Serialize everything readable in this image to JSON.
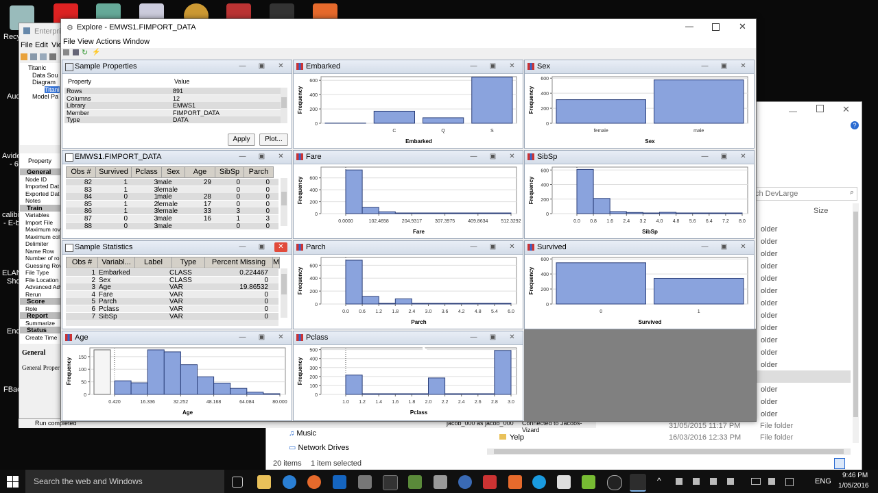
{
  "desktop": {
    "labels": [
      {
        "text": "Recy",
        "x": 5,
        "y": 48
      },
      {
        "text": "Aud",
        "x": 10,
        "y": 135
      },
      {
        "text": "Avide",
        "x": 3,
        "y": 222
      },
      {
        "text": "- 6",
        "x": 14,
        "y": 234
      },
      {
        "text": "calibi",
        "x": 3,
        "y": 308
      },
      {
        "text": "- E-b",
        "x": 5,
        "y": 320
      },
      {
        "text": "ELAN",
        "x": 3,
        "y": 393
      },
      {
        "text": "Sho",
        "x": 10,
        "y": 405
      },
      {
        "text": "Enc",
        "x": 10,
        "y": 478
      },
      {
        "text": "FBac",
        "x": 5,
        "y": 563
      }
    ]
  },
  "enterprise_miner": {
    "title": "Enterpri",
    "menu": [
      "File",
      "Edit",
      "Vie"
    ],
    "tree": [
      "Titanic",
      "Data Sou",
      "Diagram",
      "Titani",
      "Model Pa"
    ],
    "prop_header": "Property",
    "props": [
      {
        "t": "General",
        "sec": true
      },
      {
        "t": "Node ID"
      },
      {
        "t": "Imported Dat"
      },
      {
        "t": "Exported Dat"
      },
      {
        "t": "Notes"
      },
      {
        "t": "Train",
        "sec": true
      },
      {
        "t": "Variables"
      },
      {
        "t": "Import File"
      },
      {
        "t": "Maximum rov"
      },
      {
        "t": "Maximum col"
      },
      {
        "t": "Delimiter"
      },
      {
        "t": "Name Row"
      },
      {
        "t": "Number of ro"
      },
      {
        "t": "Guessing Rov"
      },
      {
        "t": "File Type"
      },
      {
        "t": "File Location"
      },
      {
        "t": "Advanced Adv"
      },
      {
        "t": "Rerun"
      },
      {
        "t": "Score",
        "sec": true
      },
      {
        "t": "Role"
      },
      {
        "t": "Report",
        "sec": true
      },
      {
        "t": "Summarize"
      },
      {
        "t": "Status",
        "sec": true
      },
      {
        "t": "Create Time"
      }
    ],
    "general_label": "General",
    "general_prop": "General Proper",
    "status": "Run completed",
    "status2": "jacob_000 as jacob_000",
    "status3": "Connected to Jacobs-Vizard"
  },
  "explore": {
    "title": "Explore - EMWS1.FIMPORT_DATA",
    "menu": [
      "File",
      "View",
      "Actions",
      "Window"
    ]
  },
  "sample_properties": {
    "title": "Sample Properties",
    "headers": [
      "Property",
      "Value"
    ],
    "rows": [
      [
        "Rows",
        "891"
      ],
      [
        "Columns",
        "12"
      ],
      [
        "Library",
        "EMWS1"
      ],
      [
        "Member",
        "FIMPORT_DATA"
      ],
      [
        "Type",
        "DATA"
      ]
    ],
    "apply": "Apply",
    "plot": "Plot..."
  },
  "data_table": {
    "title": "EMWS1.FIMPORT_DATA",
    "headers": [
      "Obs #",
      "Survived",
      "Pclass",
      "Sex",
      "Age",
      "SibSp",
      "Parch"
    ],
    "rows": [
      [
        "82",
        "1",
        "3",
        "male",
        "29",
        "0",
        "0"
      ],
      [
        "83",
        "1",
        "3",
        "female",
        "",
        "0",
        "0"
      ],
      [
        "84",
        "0",
        "1",
        "male",
        "28",
        "0",
        "0"
      ],
      [
        "85",
        "1",
        "2",
        "female",
        "17",
        "0",
        "0"
      ],
      [
        "86",
        "1",
        "3",
        "female",
        "33",
        "3",
        "0"
      ],
      [
        "87",
        "0",
        "3",
        "male",
        "16",
        "1",
        "3"
      ],
      [
        "88",
        "0",
        "3",
        "male",
        "",
        "0",
        "0"
      ]
    ]
  },
  "sample_stats": {
    "title": "Sample Statistics",
    "headers": [
      "Obs #",
      "Variabl...",
      "Label",
      "Type",
      "Percent Missing",
      "Mi"
    ],
    "rows": [
      [
        "1",
        "Embarked",
        "",
        "CLASS",
        "0.224467"
      ],
      [
        "2",
        "Sex",
        "",
        "CLASS",
        "0"
      ],
      [
        "3",
        "Age",
        "",
        "VAR",
        "19.86532"
      ],
      [
        "4",
        "Fare",
        "",
        "VAR",
        "0"
      ],
      [
        "5",
        "Parch",
        "",
        "VAR",
        "0"
      ],
      [
        "6",
        "Pclass",
        "",
        "VAR",
        "0"
      ],
      [
        "7",
        "SibSp",
        "",
        "VAR",
        "0"
      ]
    ]
  },
  "chart_data": [
    {
      "id": "embarked",
      "type": "bar",
      "title": "Embarked",
      "xlabel": "Embarked",
      "ylabel": "Frequency",
      "ylim": [
        0,
        650
      ],
      "yticks": [
        0,
        200,
        400,
        600
      ],
      "categories": [
        "",
        "C",
        "Q",
        "S"
      ],
      "values": [
        2,
        168,
        77,
        644
      ]
    },
    {
      "id": "sex",
      "type": "bar",
      "title": "Sex",
      "xlabel": "Sex",
      "ylabel": "Frequency",
      "ylim": [
        0,
        620
      ],
      "yticks": [
        0,
        200,
        400,
        600
      ],
      "categories": [
        "female",
        "male"
      ],
      "values": [
        314,
        577
      ]
    },
    {
      "id": "fare",
      "type": "bar",
      "title": "Fare",
      "xlabel": "Fare",
      "ylabel": "Frequency",
      "ylim": [
        0,
        780
      ],
      "yticks": [
        0,
        200,
        400,
        600
      ],
      "tick_labels": [
        "0.0000",
        "102.4658",
        "204.9317",
        "307.3975",
        "409.8634",
        "512.3292"
      ],
      "bins": 10,
      "values": [
        732,
        106,
        31,
        2,
        11,
        6,
        0,
        0,
        0,
        3
      ]
    },
    {
      "id": "sibsp",
      "type": "bar",
      "title": "SibSp",
      "xlabel": "SibSp",
      "ylabel": "Frequency",
      "ylim": [
        0,
        640
      ],
      "yticks": [
        0,
        200,
        400,
        600
      ],
      "tick_labels": [
        "0.0",
        "0.8",
        "1.6",
        "2.4",
        "3.2",
        "4.0",
        "4.8",
        "5.6",
        "6.4",
        "7.2",
        "8.0"
      ],
      "bins": 10,
      "values": [
        608,
        209,
        28,
        16,
        0,
        18,
        0,
        0,
        0,
        7
      ]
    },
    {
      "id": "parch",
      "type": "bar",
      "title": "Parch",
      "xlabel": "Parch",
      "ylabel": "Frequency",
      "ylim": [
        0,
        720
      ],
      "yticks": [
        0,
        200,
        400,
        600
      ],
      "tick_labels": [
        "0.0",
        "0.6",
        "1.2",
        "1.8",
        "2.4",
        "3.0",
        "3.6",
        "4.2",
        "4.8",
        "5.4",
        "6.0"
      ],
      "bins": 10,
      "values": [
        678,
        118,
        0,
        80,
        0,
        5,
        4,
        0,
        5,
        1
      ]
    },
    {
      "id": "survived",
      "type": "bar",
      "title": "Survived",
      "xlabel": "Survived",
      "ylabel": "Frequency",
      "ylim": [
        0,
        620
      ],
      "yticks": [
        0,
        200,
        400,
        600
      ],
      "categories": [
        "0",
        "1"
      ],
      "values": [
        549,
        342
      ]
    },
    {
      "id": "age",
      "type": "bar",
      "title": "Age",
      "xlabel": "Age",
      "ylabel": "Frequency",
      "ylim": [
        0,
        185
      ],
      "yticks": [
        0,
        50,
        100,
        150
      ],
      "tick_labels": [
        "0.420",
        "16.336",
        "32.252",
        "48.168",
        "64.084",
        "80.000"
      ],
      "missing": 177,
      "bins": 10,
      "values": [
        54,
        46,
        177,
        169,
        118,
        70,
        45,
        24,
        9,
        2
      ]
    },
    {
      "id": "pclass",
      "type": "bar",
      "title": "Pclass",
      "xlabel": "Pclass",
      "ylabel": "Frequency",
      "ylim": [
        0,
        520
      ],
      "yticks": [
        0,
        100,
        200,
        300,
        400,
        500
      ],
      "tick_labels": [
        "1.0",
        "1.2",
        "1.4",
        "1.6",
        "1.8",
        "2.0",
        "2.2",
        "2.4",
        "2.6",
        "2.8",
        "3.0"
      ],
      "bins": 10,
      "values": [
        216,
        0,
        0,
        0,
        0,
        184,
        0,
        0,
        0,
        491
      ]
    }
  ],
  "file_explorer": {
    "search": "ch DevLarge",
    "size_header": "Size",
    "folder_label": "older",
    "rows": [
      {
        "name": "Music",
        "date": "",
        "type": ""
      },
      {
        "name": "Network Drives",
        "date": "",
        "type": ""
      }
    ],
    "yelp": {
      "name": "Yelp",
      "date": "16/03/2016 12:33 PM",
      "type": "File folder"
    },
    "prev": {
      "date": "31/05/2015 11:17 PM",
      "type": "File folder"
    },
    "status_items": "20 items",
    "status_selected": "1 item selected"
  },
  "taskbar": {
    "search": "Search the web and Windows",
    "time": "9:46 PM",
    "date": "1/05/2016",
    "lang": "ENG"
  }
}
